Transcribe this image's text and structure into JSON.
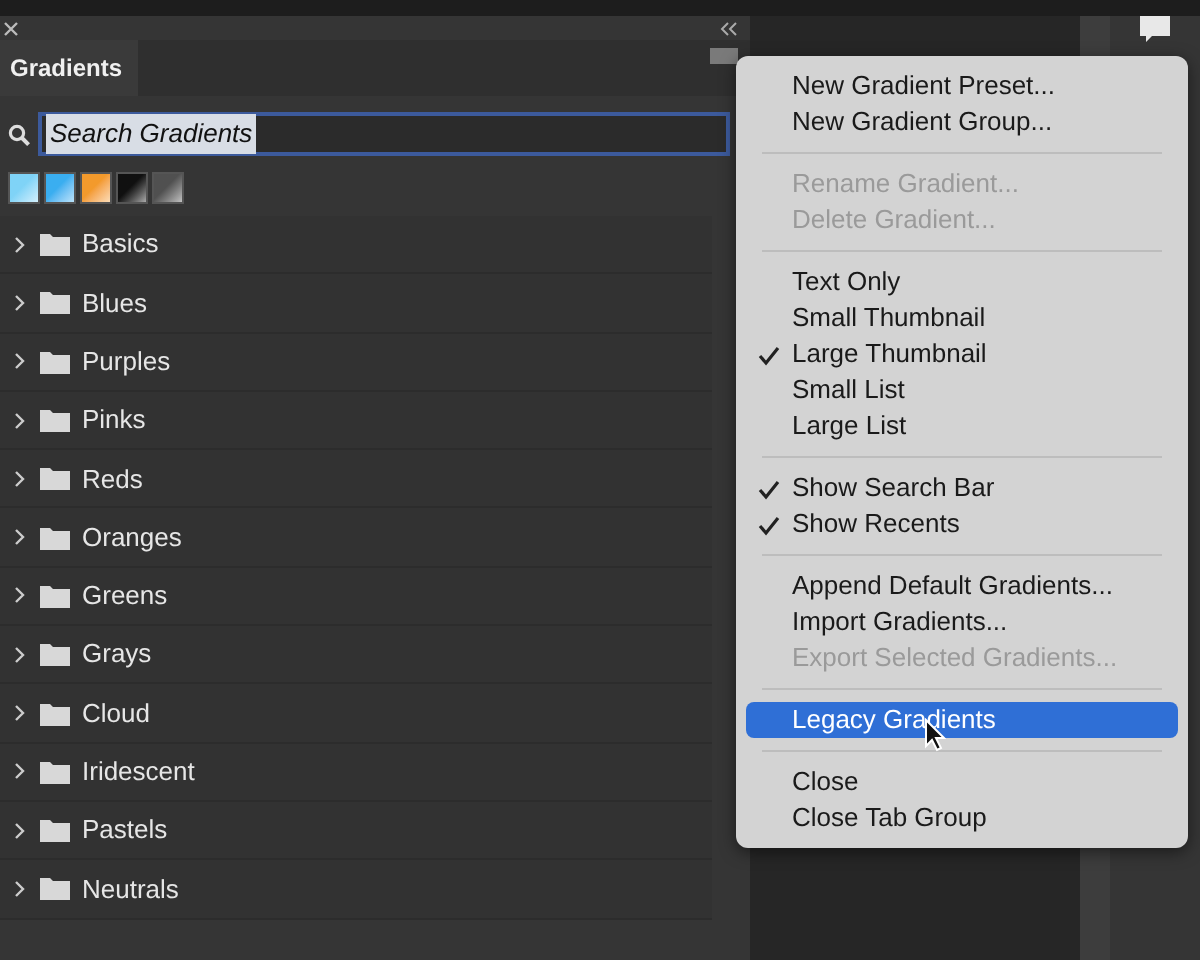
{
  "panel": {
    "tabs": [
      {
        "label": "Gradients",
        "selected": true
      }
    ],
    "search": {
      "value": "Search Gradients"
    },
    "recent_swatches": [
      {
        "color": "#7fd3f7"
      },
      {
        "color": "#3aaef0"
      },
      {
        "color": "#f39a2c"
      },
      {
        "color": "#101010"
      },
      {
        "color": "#505050"
      }
    ],
    "folders": [
      {
        "label": "Basics",
        "expanded": false
      },
      {
        "label": "Blues",
        "expanded": false
      },
      {
        "label": "Purples",
        "expanded": false
      },
      {
        "label": "Pinks",
        "expanded": false
      },
      {
        "label": "Reds",
        "expanded": false
      },
      {
        "label": "Oranges",
        "expanded": false
      },
      {
        "label": "Greens",
        "expanded": false
      },
      {
        "label": "Grays",
        "expanded": false
      },
      {
        "label": "Cloud",
        "expanded": false
      },
      {
        "label": "Iridescent",
        "expanded": false
      },
      {
        "label": "Pastels",
        "expanded": false
      },
      {
        "label": "Neutrals",
        "expanded": false
      }
    ]
  },
  "menu": {
    "groups": [
      {
        "items": [
          {
            "label": "New Gradient Preset...",
            "disabled": false,
            "checked": false,
            "selected": false
          },
          {
            "label": "New Gradient Group...",
            "disabled": false,
            "checked": false,
            "selected": false
          }
        ]
      },
      {
        "items": [
          {
            "label": "Rename Gradient...",
            "disabled": true,
            "checked": false,
            "selected": false
          },
          {
            "label": "Delete Gradient...",
            "disabled": true,
            "checked": false,
            "selected": false
          }
        ]
      },
      {
        "items": [
          {
            "label": "Text Only",
            "disabled": false,
            "checked": false,
            "selected": false
          },
          {
            "label": "Small Thumbnail",
            "disabled": false,
            "checked": false,
            "selected": false
          },
          {
            "label": "Large Thumbnail",
            "disabled": false,
            "checked": true,
            "selected": false
          },
          {
            "label": "Small List",
            "disabled": false,
            "checked": false,
            "selected": false
          },
          {
            "label": "Large List",
            "disabled": false,
            "checked": false,
            "selected": false
          }
        ]
      },
      {
        "items": [
          {
            "label": "Show Search Bar",
            "disabled": false,
            "checked": true,
            "selected": false
          },
          {
            "label": "Show Recents",
            "disabled": false,
            "checked": true,
            "selected": false
          }
        ]
      },
      {
        "items": [
          {
            "label": "Append Default Gradients...",
            "disabled": false,
            "checked": false,
            "selected": false
          },
          {
            "label": "Import Gradients...",
            "disabled": false,
            "checked": false,
            "selected": false
          },
          {
            "label": "Export Selected Gradients...",
            "disabled": true,
            "checked": false,
            "selected": false
          }
        ]
      },
      {
        "items": [
          {
            "label": "Legacy Gradients",
            "disabled": false,
            "checked": false,
            "selected": true
          }
        ]
      },
      {
        "items": [
          {
            "label": "Close",
            "disabled": false,
            "checked": false,
            "selected": false
          },
          {
            "label": "Close Tab Group",
            "disabled": false,
            "checked": false,
            "selected": false
          }
        ]
      }
    ]
  }
}
